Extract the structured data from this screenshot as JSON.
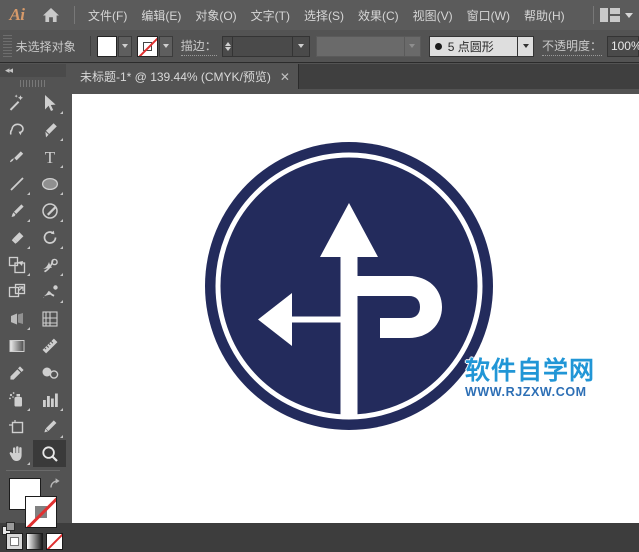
{
  "app": {
    "name": "Adobe Illustrator",
    "logo_text": "Ai",
    "home_icon": "home-icon",
    "workspace_icon": "workspace-switcher-icon",
    "workspace_chevron": "chevron-down-icon"
  },
  "menubar": {
    "items": [
      {
        "label": "文件(F)",
        "name": "menu-file"
      },
      {
        "label": "编辑(E)",
        "name": "menu-edit"
      },
      {
        "label": "对象(O)",
        "name": "menu-object"
      },
      {
        "label": "文字(T)",
        "name": "menu-type"
      },
      {
        "label": "选择(S)",
        "name": "menu-select"
      },
      {
        "label": "效果(C)",
        "name": "menu-effect"
      },
      {
        "label": "视图(V)",
        "name": "menu-view"
      },
      {
        "label": "窗口(W)",
        "name": "menu-window"
      },
      {
        "label": "帮助(H)",
        "name": "menu-help"
      }
    ]
  },
  "controlbar": {
    "selection_status": "未选择对象",
    "fill_swatch": "#ffffff",
    "fill_label": "fill-color",
    "stroke_swatch": "none",
    "stroke_label": "stroke-color",
    "stroke_weight_label": "描边：",
    "stroke_weight_value": "",
    "stroke_profile_value": "",
    "brush_label": "5 点圆形",
    "opacity_label": "不透明度：",
    "opacity_value": "100%"
  },
  "toolbar": {
    "collapse_glyph": "◂◂",
    "tools": [
      {
        "name": "tool-magic-wand",
        "label": "魔棒工具",
        "has_flyout": false,
        "active": false
      },
      {
        "name": "tool-selection",
        "label": "选择工具",
        "has_flyout": true,
        "active": false
      },
      {
        "name": "tool-lasso",
        "label": "套索工具",
        "has_flyout": false,
        "active": false
      },
      {
        "name": "tool-pen",
        "label": "钢笔工具",
        "has_flyout": true,
        "active": false
      },
      {
        "name": "tool-blob-brush",
        "label": "斑点画笔工具",
        "has_flyout": false,
        "active": false
      },
      {
        "name": "tool-type",
        "label": "文字工具",
        "has_flyout": true,
        "active": false
      },
      {
        "name": "tool-line-segment",
        "label": "直线段工具",
        "has_flyout": true,
        "active": false
      },
      {
        "name": "tool-ellipse",
        "label": "椭圆工具",
        "has_flyout": true,
        "active": false
      },
      {
        "name": "tool-paintbrush",
        "label": "画笔工具",
        "has_flyout": true,
        "active": false
      },
      {
        "name": "tool-shaper",
        "label": "Shaper 工具",
        "has_flyout": true,
        "active": false
      },
      {
        "name": "tool-eraser",
        "label": "橡皮擦工具",
        "has_flyout": true,
        "active": false
      },
      {
        "name": "tool-rotate",
        "label": "旋转工具",
        "has_flyout": true,
        "active": false
      },
      {
        "name": "tool-scale",
        "label": "比例缩放工具",
        "has_flyout": true,
        "active": false
      },
      {
        "name": "tool-width",
        "label": "宽度工具",
        "has_flyout": true,
        "active": false
      },
      {
        "name": "tool-free-transform",
        "label": "自由变换工具",
        "has_flyout": false,
        "active": false
      },
      {
        "name": "tool-shape-builder",
        "label": "形状生成器工具",
        "has_flyout": true,
        "active": false
      },
      {
        "name": "tool-perspective-grid",
        "label": "透视网格工具",
        "has_flyout": true,
        "active": false
      },
      {
        "name": "tool-mesh",
        "label": "网格工具",
        "has_flyout": false,
        "active": false
      },
      {
        "name": "tool-gradient",
        "label": "渐变工具",
        "has_flyout": false,
        "active": false
      },
      {
        "name": "tool-measure",
        "label": "度量工具",
        "has_flyout": false,
        "active": false
      },
      {
        "name": "tool-eyedropper",
        "label": "吸管工具",
        "has_flyout": false,
        "active": false
      },
      {
        "name": "tool-blend",
        "label": "混合工具",
        "has_flyout": false,
        "active": false
      },
      {
        "name": "tool-symbol-sprayer",
        "label": "符号喷枪工具",
        "has_flyout": true,
        "active": false
      },
      {
        "name": "tool-column-graph",
        "label": "柱形图工具",
        "has_flyout": true,
        "active": false
      },
      {
        "name": "tool-artboard",
        "label": "画板工具",
        "has_flyout": false,
        "active": false
      },
      {
        "name": "tool-slice",
        "label": "切片工具",
        "has_flyout": true,
        "active": false
      },
      {
        "name": "tool-hand",
        "label": "抓手工具",
        "has_flyout": true,
        "active": false
      },
      {
        "name": "tool-zoom",
        "label": "缩放工具",
        "has_flyout": false,
        "active": true
      }
    ],
    "fill_color": "#ffffff",
    "stroke_color": "none",
    "swap_icon": "swap-fill-stroke-icon",
    "default_icon": "default-fill-stroke-icon",
    "modes": [
      {
        "name": "mode-color",
        "label": "颜色"
      },
      {
        "name": "mode-gradient",
        "label": "渐变"
      },
      {
        "name": "mode-none",
        "label": "无"
      }
    ]
  },
  "tabbar": {
    "document_title": "未标题-1* @ 139.44% (CMYK/预览)",
    "close_glyph": "✕"
  },
  "canvas": {
    "zoom_level": "139.44%",
    "color_mode": "CMYK/预览",
    "artwork": {
      "name": "traffic-sign-straight-left-right-turn",
      "sign_color": "#232b5c",
      "ring_color": "#ffffff",
      "arrow_color": "#ffffff",
      "background": "#ffffff"
    },
    "watermark": {
      "cn_text": "软件自学网",
      "url_text": "WWW.RJZXW.COM",
      "cn_color": "#2196d6",
      "url_color": "#2d6fb5"
    }
  }
}
